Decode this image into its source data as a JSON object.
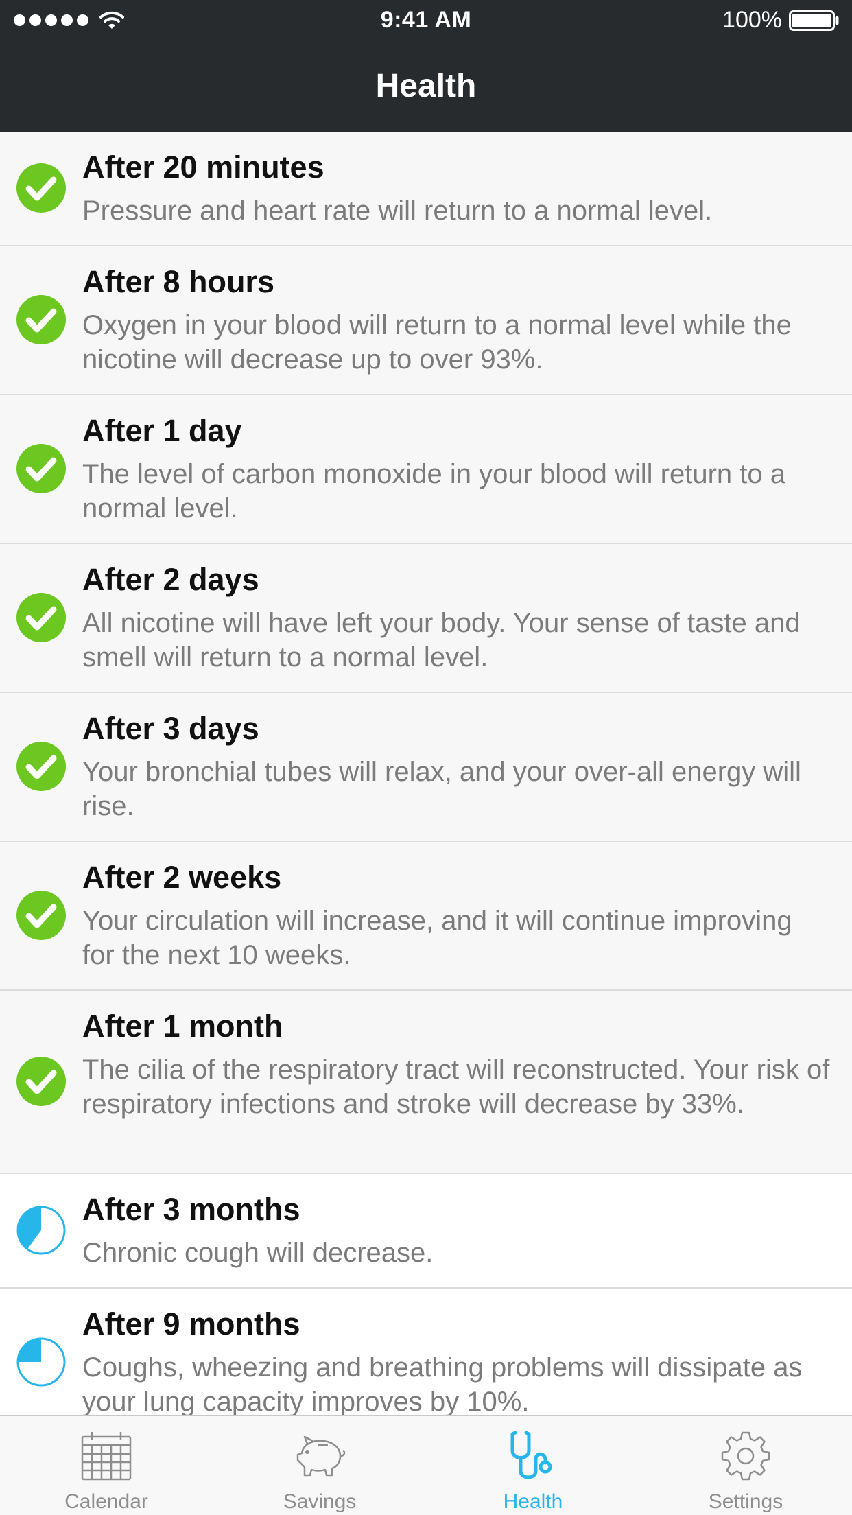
{
  "status_bar": {
    "time": "9:41 AM",
    "battery": "100%"
  },
  "nav": {
    "title": "Health"
  },
  "colors": {
    "header_bg": "#272b2e",
    "done_green": "#6cc820",
    "pending_blue": "#27b6ea",
    "done_row_bg": "#f7f7f7",
    "active_tab": "#27b6ea"
  },
  "milestones": [
    {
      "title": "After 20 minutes",
      "desc": "Pressure and heart rate will return to a normal level.",
      "status": "done",
      "icon": "check-circle-icon"
    },
    {
      "title": "After 8 hours",
      "desc": "Oxygen in your blood will return to a normal level while the nicotine will decrease up to over 93%.",
      "status": "done",
      "icon": "check-circle-icon"
    },
    {
      "title": "After 1 day",
      "desc": "The level of carbon monoxide in your blood will return to a normal level.",
      "status": "done",
      "icon": "check-circle-icon"
    },
    {
      "title": "After 2 days",
      "desc": "All nicotine will have left your body. Your sense of taste and smell will return to a normal level.",
      "status": "done",
      "icon": "check-circle-icon"
    },
    {
      "title": "After 3 days",
      "desc": "Your bronchial tubes will relax, and your over-all energy will rise.",
      "status": "done",
      "icon": "check-circle-icon"
    },
    {
      "title": "After 2 weeks",
      "desc": "Your circulation will increase, and it will continue improving for the next 10 weeks.",
      "status": "done",
      "icon": "check-circle-icon"
    },
    {
      "title": "After 1 month",
      "desc": "The cilia of the respiratory tract will reconstructed. Your risk of respiratory infections and stroke will decrease by 33%.",
      "status": "done",
      "icon": "check-circle-icon"
    },
    {
      "title": "After 3 months",
      "desc": "Chronic cough will decrease.",
      "status": "in-progress",
      "progress": 0.4,
      "icon": "progress-pie-icon"
    },
    {
      "title": "After 9 months",
      "desc": "Coughs, wheezing and breathing problems will dissipate as your lung capacity improves by 10%.",
      "status": "in-progress",
      "progress": 0.25,
      "icon": "progress-pie-icon"
    }
  ],
  "tabs": [
    {
      "label": "Calendar",
      "icon": "calendar-icon",
      "active": false
    },
    {
      "label": "Savings",
      "icon": "piggy-bank-icon",
      "active": false
    },
    {
      "label": "Health",
      "icon": "stethoscope-icon",
      "active": true
    },
    {
      "label": "Settings",
      "icon": "gear-icon",
      "active": false
    }
  ]
}
